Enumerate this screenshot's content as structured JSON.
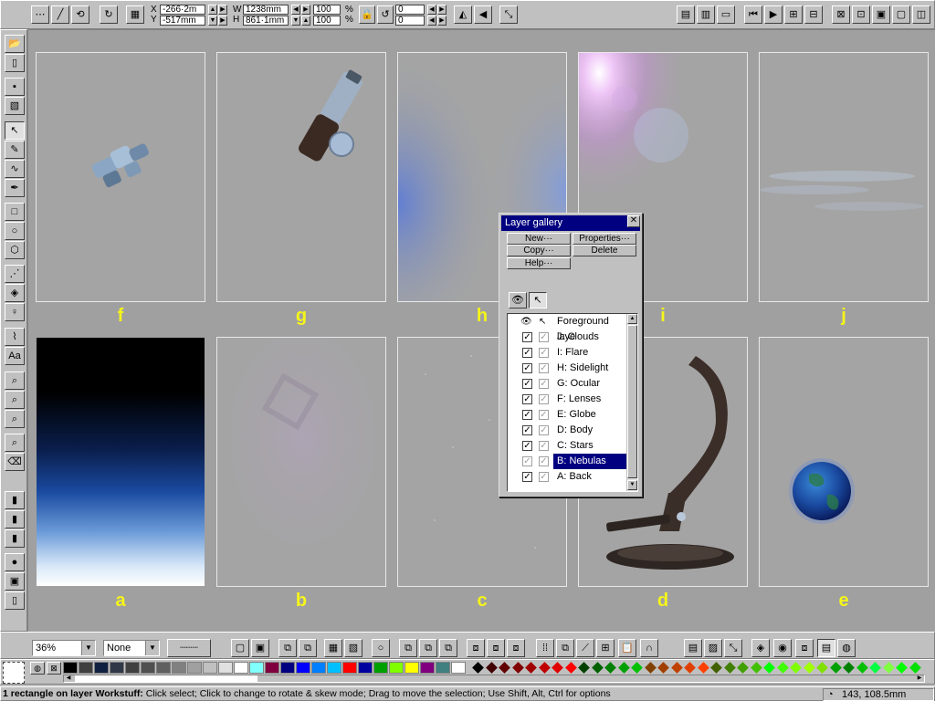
{
  "toolbar": {
    "x_value": "-266·2m",
    "y_value": "-517mm",
    "w_value": "1238mm",
    "h_value": "861·1mm",
    "scale_w": "100",
    "scale_h": "100",
    "angle_1": "0",
    "angle_2": "0",
    "x_label": "X",
    "y_label": "Y",
    "w_label": "W",
    "h_label": "H",
    "pct": "%"
  },
  "pages": [
    {
      "label": "f"
    },
    {
      "label": "g"
    },
    {
      "label": "h"
    },
    {
      "label": "i"
    },
    {
      "label": "j"
    },
    {
      "label": "a"
    },
    {
      "label": "b"
    },
    {
      "label": "c"
    },
    {
      "label": "d"
    },
    {
      "label": "e"
    }
  ],
  "layer_gallery": {
    "title": "Layer gallery",
    "buttons": {
      "new": "New···",
      "properties": "Properties···",
      "copy": "Copy···",
      "delete": "Delete",
      "help": "Help···"
    },
    "header": "Foreground laye",
    "layers": [
      {
        "name": "J: Clouds",
        "visible": true,
        "editable": true,
        "selected": false
      },
      {
        "name": "I: Flare",
        "visible": true,
        "editable": true,
        "selected": false
      },
      {
        "name": "H: Sidelight",
        "visible": true,
        "editable": true,
        "selected": false
      },
      {
        "name": "G: Ocular",
        "visible": true,
        "editable": true,
        "selected": false
      },
      {
        "name": "F: Lenses",
        "visible": true,
        "editable": true,
        "selected": false
      },
      {
        "name": "E: Globe",
        "visible": true,
        "editable": true,
        "selected": false
      },
      {
        "name": "D: Body",
        "visible": true,
        "editable": true,
        "selected": false
      },
      {
        "name": "C: Stars",
        "visible": true,
        "editable": true,
        "selected": false
      },
      {
        "name": "B: Nebulas",
        "visible": false,
        "editable": false,
        "selected": true
      },
      {
        "name": "A: Back",
        "visible": true,
        "editable": true,
        "selected": false
      }
    ]
  },
  "bottom": {
    "zoom": "36%",
    "quality": "None"
  },
  "palette": {
    "swatches": [
      "#000000",
      "#404040",
      "#102040",
      "#303848",
      "#404040",
      "#505050",
      "#606060",
      "#808080",
      "#a0a0a0",
      "#c0c0c0",
      "#e0e0e0",
      "#ffffff",
      "#80ffff",
      "#800040",
      "#000080",
      "#0000ff",
      "#0080ff",
      "#00c0ff",
      "#ff0000",
      "#0000a0",
      "#00a000",
      "#80ff00",
      "#ffff00",
      "#800080",
      "#408080",
      "#ffffff"
    ],
    "diamonds": [
      "#000000",
      "#400000",
      "#600000",
      "#800000",
      "#a00000",
      "#c00000",
      "#e00000",
      "#ff0000",
      "#004000",
      "#006000",
      "#008000",
      "#00a000",
      "#00c000",
      "#804000",
      "#a04000",
      "#c04000",
      "#e04000",
      "#ff4000",
      "#406000",
      "#408000",
      "#40a000",
      "#40c000",
      "#00ff00",
      "#40ff00",
      "#80ff00",
      "#a0ff00",
      "#80e000",
      "#00a000",
      "#008000",
      "#00c000",
      "#00ff40",
      "#80ff40",
      "#00ff00",
      "#00e000"
    ]
  },
  "status": {
    "bold": "1 rectangle on layer Workstuff:",
    "text": " Click select; Click to change to rotate & skew mode; Drag to move the selection; Use Shift, Alt, Ctrl for options",
    "coords": "143, 108.5mm"
  }
}
